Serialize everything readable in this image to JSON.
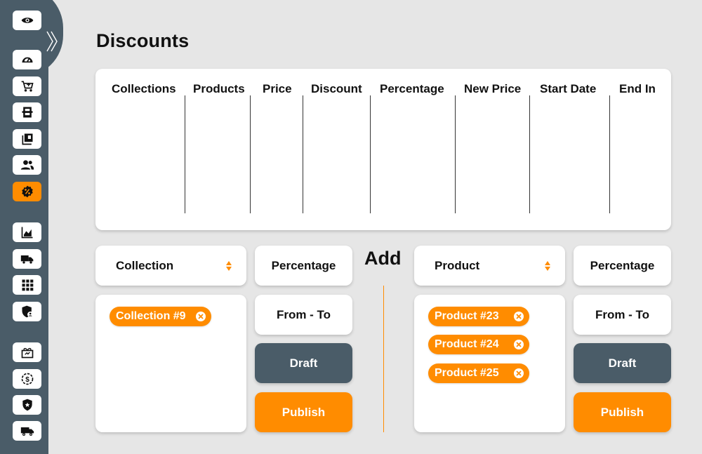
{
  "page": {
    "title": "Discounts"
  },
  "sidebar": {
    "items": [
      {
        "icon": "eye-icon"
      },
      {
        "icon": "speedometer-icon"
      },
      {
        "icon": "cart-icon"
      },
      {
        "icon": "crate-icon"
      },
      {
        "icon": "collections-icon"
      },
      {
        "icon": "users-icon"
      },
      {
        "icon": "discount-badge-icon",
        "active": true
      },
      {
        "icon": "chart-icon"
      },
      {
        "icon": "truck-icon"
      },
      {
        "icon": "grid-icon"
      },
      {
        "icon": "shield-user-icon"
      },
      {
        "icon": "gift-icon"
      },
      {
        "icon": "money-cycle-icon"
      },
      {
        "icon": "police-badge-icon"
      },
      {
        "icon": "delivery-truck-icon"
      }
    ]
  },
  "table": {
    "headers": [
      "Collections",
      "Products",
      "Price",
      "Discount",
      "Percentage",
      "New Price",
      "Start Date",
      "End In"
    ]
  },
  "left_form": {
    "collection_select": "Collection",
    "percentage_label": "Percentage",
    "from_to_label": "From - To",
    "draft_label": "Draft",
    "publish_label": "Publish",
    "chips": [
      "Collection #9"
    ]
  },
  "add_label": "Add",
  "right_form": {
    "product_select": "Product",
    "percentage_label": "Percentage",
    "from_to_label": "From - To",
    "draft_label": "Draft",
    "publish_label": "Publish",
    "chips": [
      "Product #23",
      "Product #24",
      "Product #25"
    ]
  },
  "colors": {
    "accent": "#ff8c00",
    "sidebar": "#4a5c68",
    "background": "#e6e6e6"
  }
}
